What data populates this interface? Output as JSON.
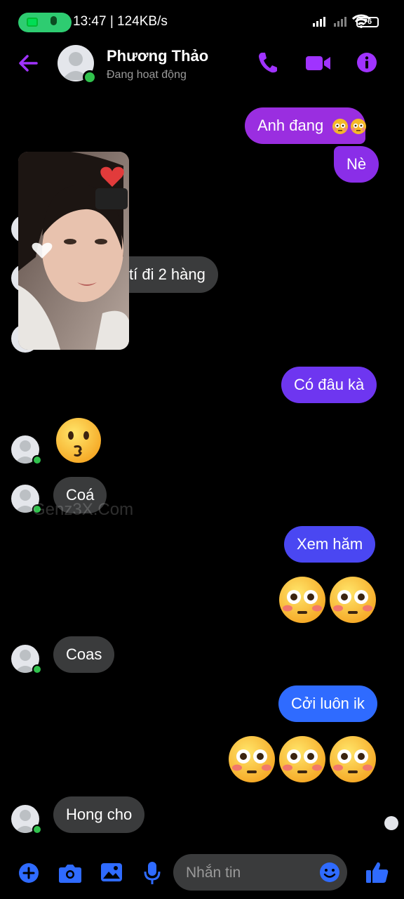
{
  "status_bar": {
    "time_speed": "13:47 | 124KB/s",
    "battery": "76"
  },
  "header": {
    "name": "Phương Thảo",
    "status": "Đang hoạt động"
  },
  "messages": {
    "m1": "Anh đang",
    "m2": "Nè",
    "m3": "tí đi 2 hàng",
    "m4": "Có đâu kà",
    "m5": "Coá",
    "m6": "Xem hăm",
    "m7": "Coas",
    "m8": "Cởi luôn ik",
    "m9": "Hong cho"
  },
  "watermark": "Genz3X.Com",
  "composer": {
    "placeholder": "Nhắn tin"
  },
  "colors": {
    "accent": "#a033ff",
    "bubble_purple": "#8e2de2",
    "bubble_violet": "#6a35f0",
    "bubble_blue": "#2f6bff",
    "incoming": "#3a3b3c",
    "online": "#31c24d"
  }
}
